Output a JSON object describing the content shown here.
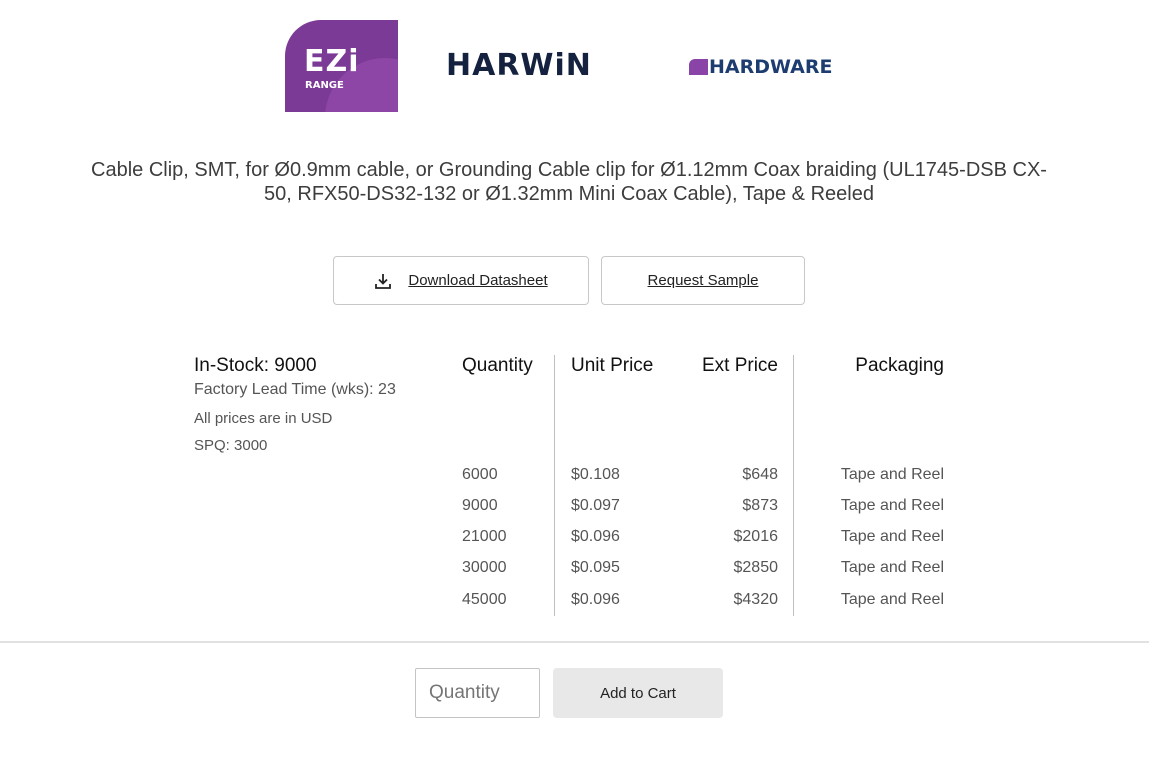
{
  "logos": {
    "ezi_big": "EZi",
    "ezi_small": "RANGE",
    "harwin": "HARWiN",
    "hardware": "HARDWARE"
  },
  "product": {
    "title": "Cable Clip, SMT, for Ø0.9mm cable, or Grounding Cable clip for Ø1.12mm Coax braiding (UL1745-DSB CX-50, RFX50-DS32-132 or Ø1.32mm Mini Coax Cable), Tape & Reeled"
  },
  "actions": {
    "download_label": "Download Datasheet",
    "sample_label": "Request Sample"
  },
  "stock": {
    "in_stock": "In-Stock: 9000",
    "lead_time": "Factory Lead Time (wks): 23",
    "currency_note": "All prices are in USD",
    "spq": "SPQ: 3000"
  },
  "pricing": {
    "headers": {
      "quantity": "Quantity",
      "unit_price": "Unit Price",
      "ext_price": "Ext Price",
      "packaging": "Packaging"
    },
    "rows": [
      {
        "qty": "6000",
        "unit": "$0.108",
        "ext": "$648",
        "pack": "Tape and Reel"
      },
      {
        "qty": "9000",
        "unit": "$0.097",
        "ext": "$873",
        "pack": "Tape and Reel"
      },
      {
        "qty": "21000",
        "unit": "$0.096",
        "ext": "$2016",
        "pack": "Tape and Reel"
      },
      {
        "qty": "30000",
        "unit": "$0.095",
        "ext": "$2850",
        "pack": "Tape and Reel"
      },
      {
        "qty": "45000",
        "unit": "$0.096",
        "ext": "$4320",
        "pack": "Tape and Reel"
      }
    ]
  },
  "cart": {
    "quantity_placeholder": "Quantity",
    "add_label": "Add to Cart"
  },
  "colors": {
    "ezi_purple": "#7b3a96",
    "harwin_navy": "#14223f",
    "hardware_blue": "#1d3d71"
  }
}
